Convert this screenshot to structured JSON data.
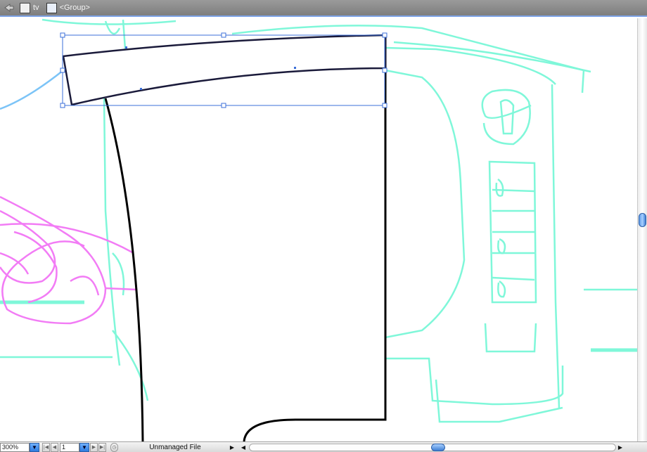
{
  "breadcrumb": {
    "layer_name": "tv",
    "group_name": "<Group>"
  },
  "canvas": {
    "sketch_color": "#7ff7d9",
    "marker_color": "#f27cf5",
    "selection_color": "#3b6fd8",
    "stroke_color": "#000000"
  },
  "statusbar": {
    "zoom_value": "300%",
    "page_value": "1",
    "status_text": "Unmanaged File"
  },
  "icons": {
    "back": "left-arrow-icon",
    "layer": "layer-icon",
    "group": "group-icon",
    "zoom_dropdown": "chevron-down-icon",
    "first_page": "first-page-icon",
    "prev_page": "prev-page-icon",
    "page_dropdown": "chevron-down-icon",
    "next_page": "next-page-icon",
    "last_page": "last-page-icon",
    "clock": "clock-icon",
    "status_menu": "triangle-right-icon",
    "scroll_left": "triangle-left-icon",
    "scroll_right": "triangle-right-icon"
  }
}
